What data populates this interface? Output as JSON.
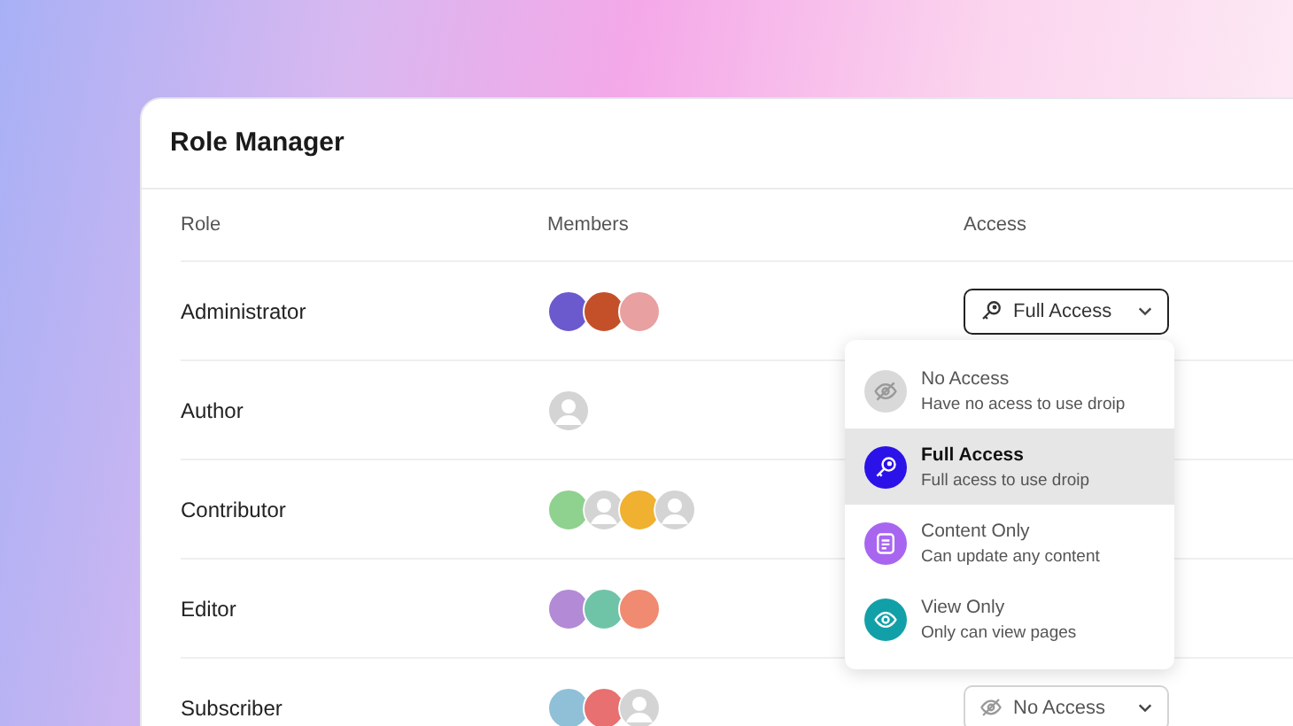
{
  "title": "Role Manager",
  "columns": [
    "Role",
    "Members",
    "Access"
  ],
  "rows": [
    {
      "role": "Administrator",
      "members": [
        {
          "kind": "photo",
          "color": "#6a5acd"
        },
        {
          "kind": "photo",
          "color": "#c4502a"
        },
        {
          "kind": "photo",
          "color": "#e8a0a0"
        }
      ],
      "access": {
        "label": "Full Access",
        "kind": "full",
        "open": true
      }
    },
    {
      "role": "Author",
      "members": [
        {
          "kind": "placeholder"
        }
      ]
    },
    {
      "role": "Contributor",
      "members": [
        {
          "kind": "photo",
          "color": "#8fd18f"
        },
        {
          "kind": "placeholder"
        },
        {
          "kind": "photo",
          "color": "#f0b030"
        },
        {
          "kind": "placeholder"
        }
      ]
    },
    {
      "role": "Editor",
      "members": [
        {
          "kind": "photo",
          "color": "#b38ad6"
        },
        {
          "kind": "photo",
          "color": "#6fc4a8"
        },
        {
          "kind": "photo",
          "color": "#f08a70"
        }
      ]
    },
    {
      "role": "Subscriber",
      "members": [
        {
          "kind": "photo",
          "color": "#8fc0d8"
        },
        {
          "kind": "photo",
          "color": "#e87070"
        },
        {
          "kind": "placeholder"
        }
      ],
      "access": {
        "label": "No Access",
        "kind": "none",
        "open": false
      }
    }
  ],
  "menu": [
    {
      "title": "No Access",
      "description": "Have no acess to use droip",
      "kind": "none",
      "color": "#d9d9d9",
      "selected": false
    },
    {
      "title": "Full Access",
      "description": "Full acess to use droip",
      "kind": "full",
      "color": "#2b12e8",
      "selected": true
    },
    {
      "title": "Content Only",
      "description": "Can update any content",
      "kind": "content",
      "color": "#a866f0",
      "selected": false
    },
    {
      "title": "View Only",
      "description": "Only can view pages",
      "kind": "view",
      "color": "#12a0a8",
      "selected": false
    }
  ]
}
